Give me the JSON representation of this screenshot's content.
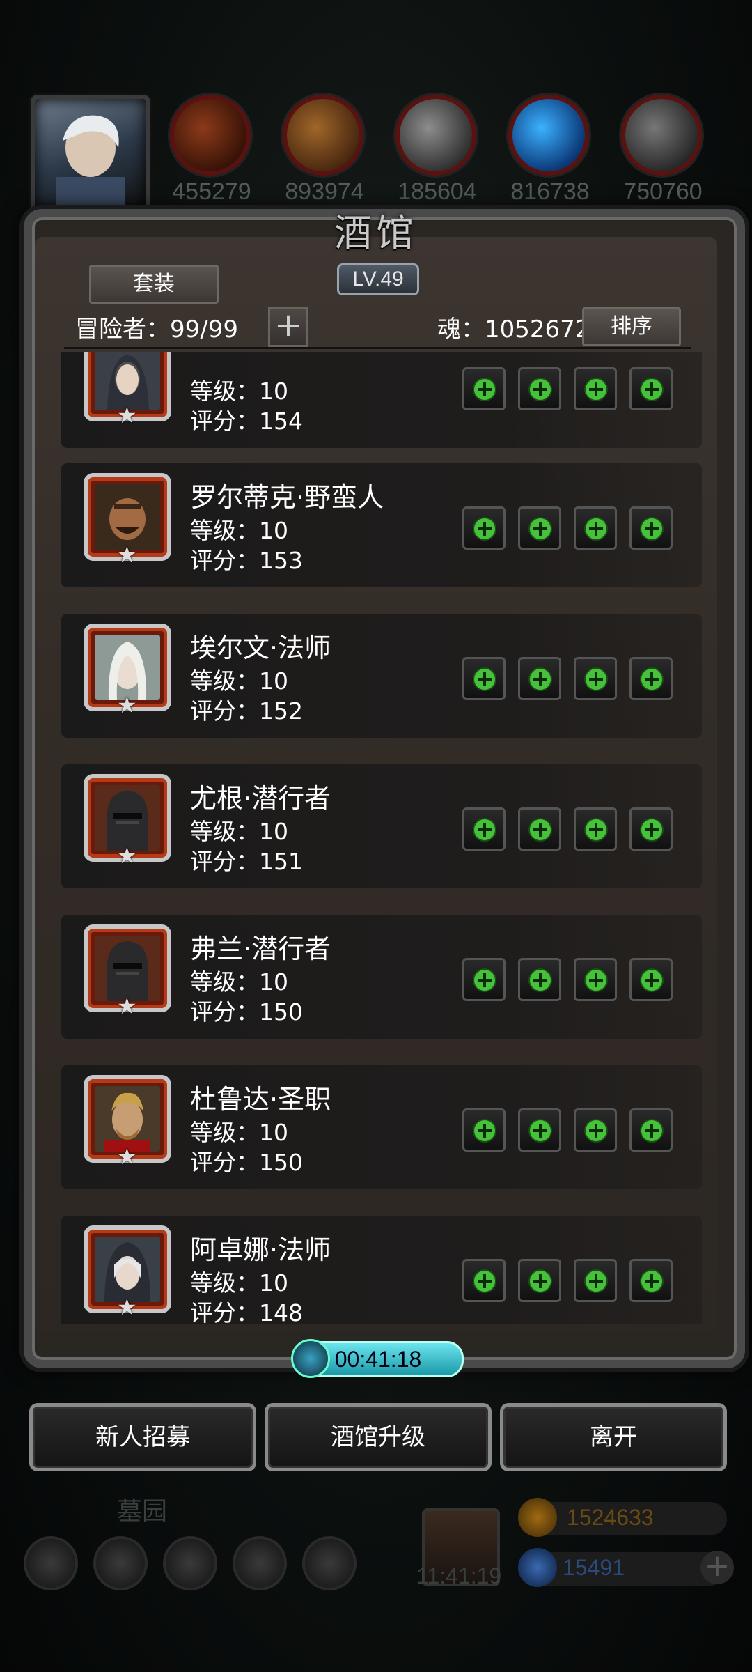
{
  "resources": [
    {
      "name": "ore-icon",
      "value": "455279"
    },
    {
      "name": "wood-icon",
      "value": "893974"
    },
    {
      "name": "iron-icon",
      "value": "185604"
    },
    {
      "name": "crystal-icon",
      "value": "816738"
    },
    {
      "name": "stone-icon",
      "value": "750760"
    }
  ],
  "panel": {
    "title": "酒馆",
    "level": "LV.49",
    "set_button": "套装",
    "adventurers": "冒险者：99/99",
    "soul": "魂：1052672",
    "sort_button": "排序"
  },
  "heroes": [
    {
      "name": "",
      "level": "等级：10",
      "score": "评分：154"
    },
    {
      "name": "罗尔蒂克·野蛮人",
      "level": "等级：10",
      "score": "评分：153"
    },
    {
      "name": "埃尔文·法师",
      "level": "等级：10",
      "score": "评分：152"
    },
    {
      "name": "尤根·潜行者",
      "level": "等级：10",
      "score": "评分：151"
    },
    {
      "name": "弗兰·潜行者",
      "level": "等级：10",
      "score": "评分：150"
    },
    {
      "name": "杜鲁达·圣职",
      "level": "等级：10",
      "score": "评分：150"
    },
    {
      "name": "阿卓娜·法师",
      "level": "等级：10",
      "score": "评分：148"
    }
  ],
  "timer": "00:41:18",
  "buttons": {
    "recruit": "新人招募",
    "upgrade": "酒馆升级",
    "leave": "离开"
  },
  "background": {
    "graveyard": "墓园",
    "gift_timer": "11:41:19",
    "gold": "1524633",
    "gems": "15491"
  },
  "colors": {
    "accent_green": "#45c23a",
    "portrait_border": "#b43a18",
    "timer_cyan": "#1b98a8"
  }
}
